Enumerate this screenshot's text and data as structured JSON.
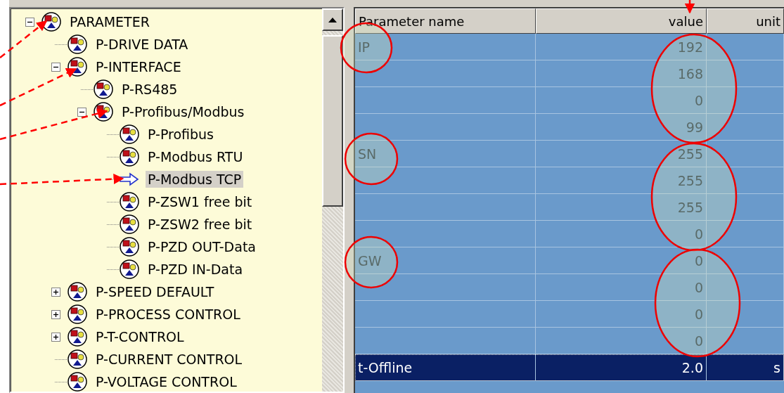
{
  "tree": [
    {
      "label": "PARAMETER",
      "kind": "node",
      "selected": false,
      "expanded": true,
      "children": [
        {
          "label": "P-DRIVE DATA",
          "kind": "node",
          "selected": false
        },
        {
          "label": "P-INTERFACE",
          "kind": "node",
          "selected": false,
          "expanded": true,
          "children": [
            {
              "label": "P-RS485",
              "kind": "node",
              "selected": false
            },
            {
              "label": "P-Profibus/Modbus",
              "kind": "node",
              "selected": false,
              "expanded": true,
              "children": [
                {
                  "label": "P-Profibus",
                  "kind": "node",
                  "selected": false
                },
                {
                  "label": "P-Modbus RTU",
                  "kind": "node",
                  "selected": false
                },
                {
                  "label": "P-Modbus TCP",
                  "kind": "current",
                  "selected": true
                },
                {
                  "label": "P-ZSW1 free bit",
                  "kind": "node",
                  "selected": false
                },
                {
                  "label": "P-ZSW2 free bit",
                  "kind": "node",
                  "selected": false
                },
                {
                  "label": "P-PZD OUT-Data",
                  "kind": "node",
                  "selected": false
                },
                {
                  "label": "P-PZD IN-Data",
                  "kind": "node",
                  "selected": false
                }
              ]
            }
          ]
        },
        {
          "label": "P-SPEED DEFAULT",
          "kind": "node",
          "selected": false,
          "expanded": false
        },
        {
          "label": "P-PROCESS CONTROL",
          "kind": "node",
          "selected": false,
          "expanded": false
        },
        {
          "label": "P-T-CONTROL",
          "kind": "node",
          "selected": false,
          "expanded": false
        },
        {
          "label": "P-CURRENT CONTROL",
          "kind": "node",
          "selected": false
        },
        {
          "label": "P-VOLTAGE CONTROL",
          "kind": "node",
          "selected": false
        }
      ]
    }
  ],
  "table": {
    "columns": [
      "Parameter name",
      "value",
      "unit"
    ],
    "rows": [
      {
        "name": "IP",
        "value": "192",
        "selected": false
      },
      {
        "value": "168",
        "selected": false
      },
      {
        "value": "0",
        "selected": false
      },
      {
        "value": "99",
        "selected": false
      },
      {
        "name": "SN",
        "value": "255",
        "selected": false
      },
      {
        "value": "255",
        "selected": false
      },
      {
        "value": "255",
        "selected": false
      },
      {
        "value": "0",
        "selected": false
      },
      {
        "name": "GW",
        "value": "0",
        "selected": false
      },
      {
        "value": "0",
        "selected": false
      },
      {
        "value": "0",
        "selected": false
      },
      {
        "value": "0",
        "selected": false
      },
      {
        "name": "t-Offline",
        "value": "2.0",
        "unit": "s",
        "selected": true
      }
    ]
  }
}
